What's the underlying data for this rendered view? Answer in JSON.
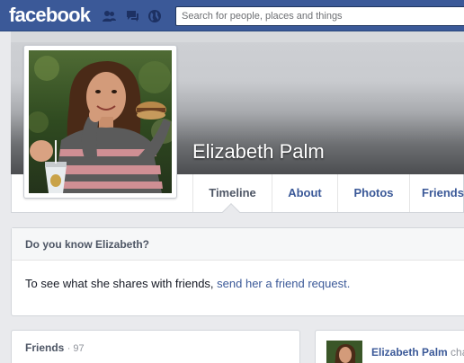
{
  "header": {
    "logo_text": "facebook",
    "search_placeholder": "Search for people, places and things",
    "icons": [
      "friend-requests-icon",
      "messages-icon",
      "notifications-globe-icon"
    ]
  },
  "profile": {
    "name": "Elizabeth Palm"
  },
  "nav": {
    "tabs": [
      {
        "label": "Timeline",
        "active": true
      },
      {
        "label": "About",
        "active": false
      },
      {
        "label": "Photos",
        "active": false
      },
      {
        "label": "Friends",
        "active": false
      }
    ]
  },
  "know_card": {
    "title": "Do you know Elizabeth?",
    "body_prefix": "To see what she shares with friends, ",
    "link_text": "send her a friend request."
  },
  "friends_card": {
    "title": "Friends",
    "count": "· 97"
  },
  "activity": {
    "name": "Elizabeth Palm",
    "verb": "cha"
  },
  "colors": {
    "brand_blue": "#3b5998",
    "page_bg": "#e9eaed",
    "link": "#3b5998"
  }
}
